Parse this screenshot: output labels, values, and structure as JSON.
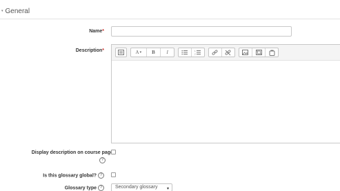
{
  "section": {
    "title": "General",
    "toggle_glyph": "▾"
  },
  "fields": {
    "name": {
      "label": "Name",
      "required_mark": "*",
      "value": ""
    },
    "description": {
      "label": "Description",
      "required_mark": "*",
      "value": ""
    },
    "display_description": {
      "label": "Display description on course page",
      "checked": false
    },
    "is_global": {
      "label": "Is this glossary global?",
      "checked": false
    },
    "glossary_type": {
      "label": "Glossary type",
      "selected": "Secondary glossary"
    }
  },
  "editor_toolbar": {
    "font_style_label": "A",
    "bold_label": "B",
    "italic_label": "I",
    "icons": [
      "collapse-icon",
      "text-style-dropdown",
      "bold-icon",
      "italic-icon",
      "unordered-list-icon",
      "ordered-list-icon",
      "link-icon",
      "unlink-icon",
      "image-icon",
      "media-icon",
      "manage-files-icon"
    ]
  },
  "help_icon_glyph": "?",
  "select_caret_glyph": "▾",
  "colors": {
    "required": "#c9302c",
    "border": "#c8c8c8",
    "toolbar_bg": "#f4f4f4"
  }
}
